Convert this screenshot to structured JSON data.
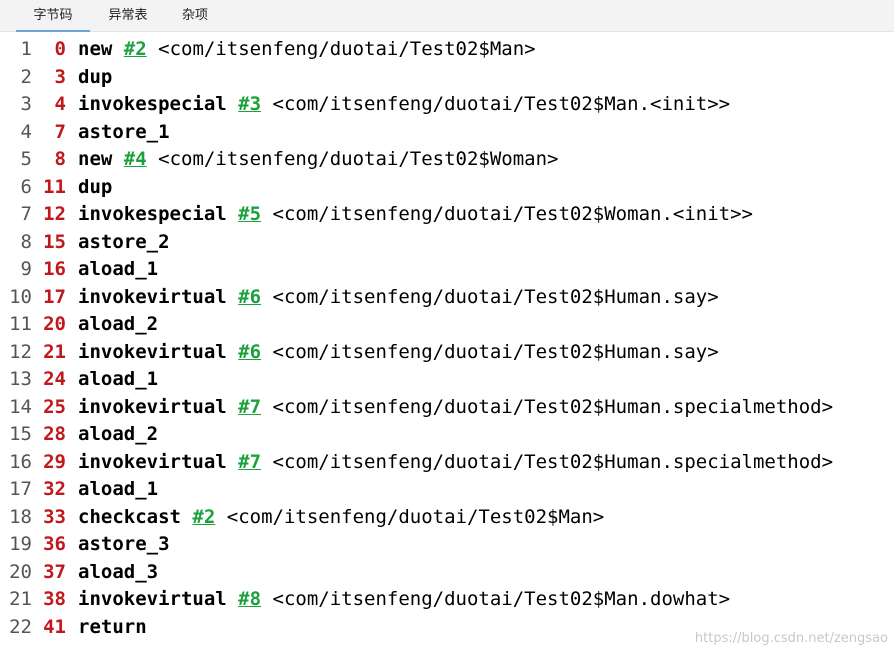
{
  "tabs": [
    {
      "label": "字节码",
      "active": true
    },
    {
      "label": "异常表",
      "active": false
    },
    {
      "label": "杂项",
      "active": false
    }
  ],
  "colors": {
    "offset": "#c0181c",
    "reference": "#1ca13c",
    "tab_active_underline": "#6aa6d8"
  },
  "instructions": [
    {
      "line": "1",
      "offset": "0",
      "op": "new",
      "ref": "#2",
      "arg": "<com/itsenfeng/duotai/Test02$Man>"
    },
    {
      "line": "2",
      "offset": "3",
      "op": "dup",
      "ref": "",
      "arg": ""
    },
    {
      "line": "3",
      "offset": "4",
      "op": "invokespecial",
      "ref": "#3",
      "arg": "<com/itsenfeng/duotai/Test02$Man.<init>>"
    },
    {
      "line": "4",
      "offset": "7",
      "op": "astore_1",
      "ref": "",
      "arg": ""
    },
    {
      "line": "5",
      "offset": "8",
      "op": "new",
      "ref": "#4",
      "arg": "<com/itsenfeng/duotai/Test02$Woman>"
    },
    {
      "line": "6",
      "offset": "11",
      "op": "dup",
      "ref": "",
      "arg": ""
    },
    {
      "line": "7",
      "offset": "12",
      "op": "invokespecial",
      "ref": "#5",
      "arg": "<com/itsenfeng/duotai/Test02$Woman.<init>>"
    },
    {
      "line": "8",
      "offset": "15",
      "op": "astore_2",
      "ref": "",
      "arg": ""
    },
    {
      "line": "9",
      "offset": "16",
      "op": "aload_1",
      "ref": "",
      "arg": ""
    },
    {
      "line": "10",
      "offset": "17",
      "op": "invokevirtual",
      "ref": "#6",
      "arg": "<com/itsenfeng/duotai/Test02$Human.say>"
    },
    {
      "line": "11",
      "offset": "20",
      "op": "aload_2",
      "ref": "",
      "arg": ""
    },
    {
      "line": "12",
      "offset": "21",
      "op": "invokevirtual",
      "ref": "#6",
      "arg": "<com/itsenfeng/duotai/Test02$Human.say>"
    },
    {
      "line": "13",
      "offset": "24",
      "op": "aload_1",
      "ref": "",
      "arg": ""
    },
    {
      "line": "14",
      "offset": "25",
      "op": "invokevirtual",
      "ref": "#7",
      "arg": "<com/itsenfeng/duotai/Test02$Human.specialmethod>"
    },
    {
      "line": "15",
      "offset": "28",
      "op": "aload_2",
      "ref": "",
      "arg": ""
    },
    {
      "line": "16",
      "offset": "29",
      "op": "invokevirtual",
      "ref": "#7",
      "arg": "<com/itsenfeng/duotai/Test02$Human.specialmethod>"
    },
    {
      "line": "17",
      "offset": "32",
      "op": "aload_1",
      "ref": "",
      "arg": ""
    },
    {
      "line": "18",
      "offset": "33",
      "op": "checkcast",
      "ref": "#2",
      "arg": "<com/itsenfeng/duotai/Test02$Man>"
    },
    {
      "line": "19",
      "offset": "36",
      "op": "astore_3",
      "ref": "",
      "arg": ""
    },
    {
      "line": "20",
      "offset": "37",
      "op": "aload_3",
      "ref": "",
      "arg": ""
    },
    {
      "line": "21",
      "offset": "38",
      "op": "invokevirtual",
      "ref": "#8",
      "arg": "<com/itsenfeng/duotai/Test02$Man.dowhat>"
    },
    {
      "line": "22",
      "offset": "41",
      "op": "return",
      "ref": "",
      "arg": ""
    }
  ],
  "watermark": "https://blog.csdn.net/zengsao"
}
